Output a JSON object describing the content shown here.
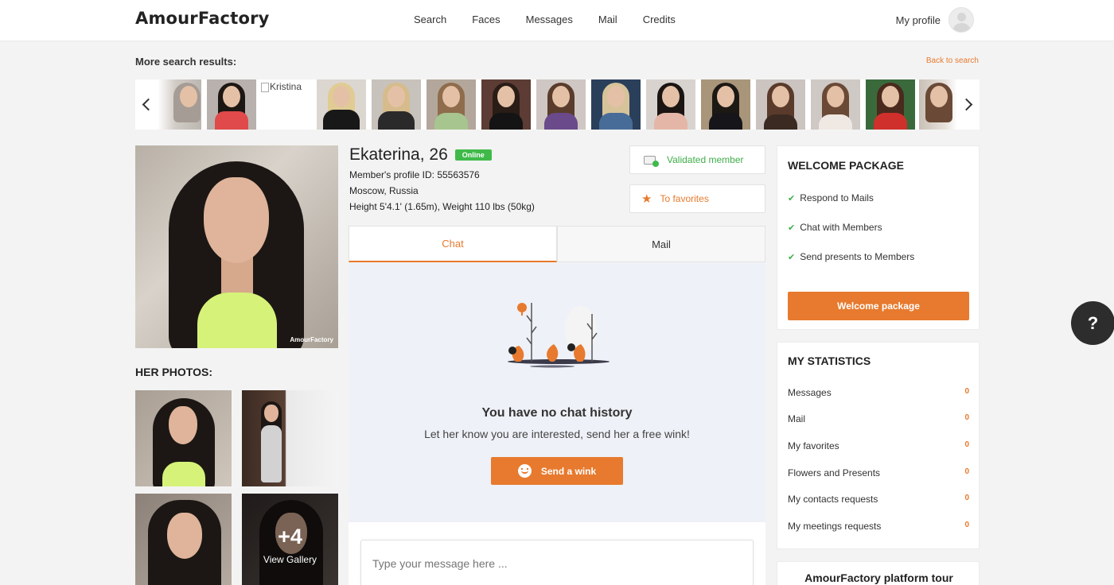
{
  "header": {
    "logo": "AmourFactory",
    "nav": [
      "Search",
      "Faces",
      "Messages",
      "Mail",
      "Credits"
    ],
    "my_profile": "My profile"
  },
  "search_results": {
    "title": "More search results:",
    "back_link": "Back to search",
    "broken_alt": "Kristina"
  },
  "profile": {
    "name": "Ekaterina, 26",
    "status": "Online",
    "profile_id": "Member's profile ID: 55563576",
    "location": "Moscow, Russia",
    "physical": "Height 5'4.1' (1.65m), Weight 110 lbs (50kg)",
    "watermark": "AmourFactory",
    "validated": "Validated member",
    "favorites": "To favorites"
  },
  "photos": {
    "title": "HER PHOTOS:",
    "more_count": "+4",
    "view_gallery": "View Gallery"
  },
  "tabs": {
    "chat": "Chat",
    "mail": "Mail"
  },
  "chat": {
    "empty_title": "You have no chat history",
    "empty_subtitle": "Let her know you are interested, send her a free wink!",
    "wink_button": "Send a wink",
    "input_placeholder": "Type your message here ..."
  },
  "welcome": {
    "title": "WELCOME PACKAGE",
    "items": [
      "Respond to Mails",
      "Chat with Members",
      "Send presents to Members"
    ],
    "button": "Welcome package"
  },
  "stats": {
    "title": "MY STATISTICS",
    "rows": [
      {
        "label": "Messages",
        "value": "0"
      },
      {
        "label": "Mail",
        "value": "0"
      },
      {
        "label": "My favorites",
        "value": "0"
      },
      {
        "label": "Flowers and Presents",
        "value": "0"
      },
      {
        "label": "My contacts requests",
        "value": "0"
      },
      {
        "label": "My meetings requests",
        "value": "0"
      }
    ]
  },
  "tour": {
    "title": "AmourFactory platform tour"
  },
  "help": {
    "label": "?"
  },
  "colors": {
    "accent": "#e77a2e",
    "online": "#3fba49",
    "help_button": "#2d2d2d"
  }
}
